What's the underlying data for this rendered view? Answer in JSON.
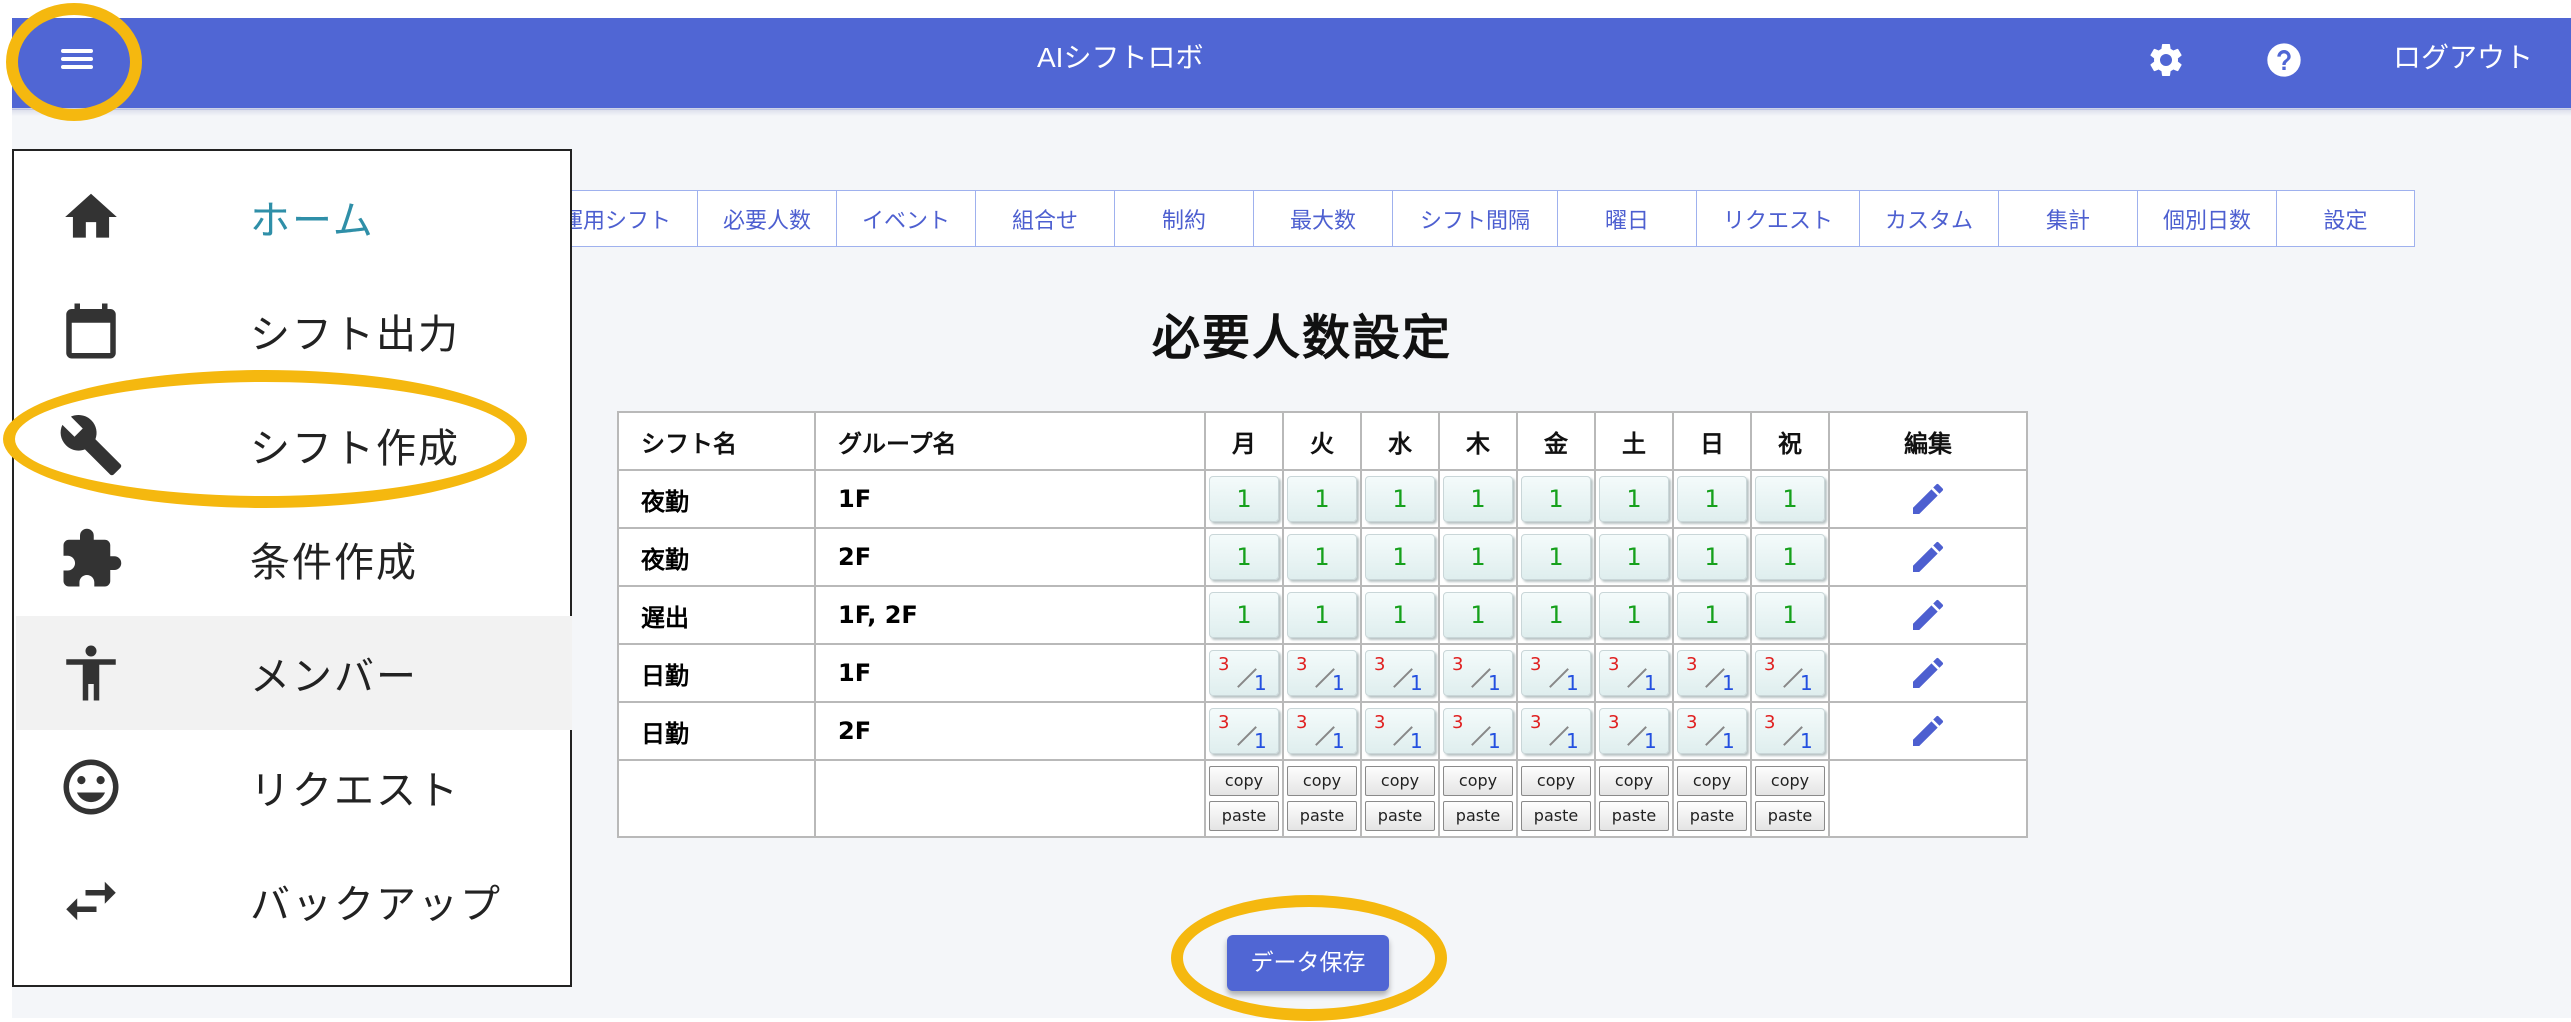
{
  "header": {
    "title": "AIシフトロボ",
    "logout_label": "ログアウト",
    "menu_icon": "menu-icon",
    "settings_icon": "gear-icon",
    "help_icon": "help-icon"
  },
  "tabs": [
    "運用シフト",
    "必要人数",
    "イベント",
    "組合せ",
    "制約",
    "最大数",
    "シフト間隔",
    "曜日",
    "リクエスト",
    "カスタム",
    "集計",
    "個別日数",
    "設定"
  ],
  "page_title": "必要人数設定",
  "table": {
    "headers": {
      "shift": "シフト名",
      "group": "グループ名",
      "days": [
        "月",
        "火",
        "水",
        "木",
        "金",
        "土",
        "日",
        "祝"
      ],
      "edit": "編集"
    },
    "rows": [
      {
        "shift": "夜勤",
        "group": "1F",
        "type": "single",
        "value": "1"
      },
      {
        "shift": "夜勤",
        "group": "2F",
        "type": "single",
        "value": "1"
      },
      {
        "shift": "遅出",
        "group": "1F, 2F",
        "type": "single",
        "value": "1"
      },
      {
        "shift": "日勤",
        "group": "1F",
        "type": "range",
        "max": "3",
        "min": "1"
      },
      {
        "shift": "日勤",
        "group": "2F",
        "type": "range",
        "max": "3",
        "min": "1"
      }
    ],
    "copy_label": "copy",
    "paste_label": "paste"
  },
  "save_button": "データ保存",
  "drawer": {
    "items": [
      {
        "label": "ホーム",
        "icon": "home-icon"
      },
      {
        "label": "シフト出力",
        "icon": "calendar-icon"
      },
      {
        "label": "シフト作成",
        "icon": "wrench-icon"
      },
      {
        "label": "条件作成",
        "icon": "puzzle-icon"
      },
      {
        "label": "メンバー",
        "icon": "person-icon"
      },
      {
        "label": "リクエスト",
        "icon": "smiley-icon"
      },
      {
        "label": "バックアップ",
        "icon": "swap-icon"
      }
    ]
  },
  "colors": {
    "primary": "#5066d4",
    "tab_text": "#4d5fd0",
    "highlight": "#f5b80f",
    "value_green": "#16a01c",
    "max_red": "#e02020",
    "min_blue": "#2450e0",
    "home_active": "#2f8fa8"
  }
}
